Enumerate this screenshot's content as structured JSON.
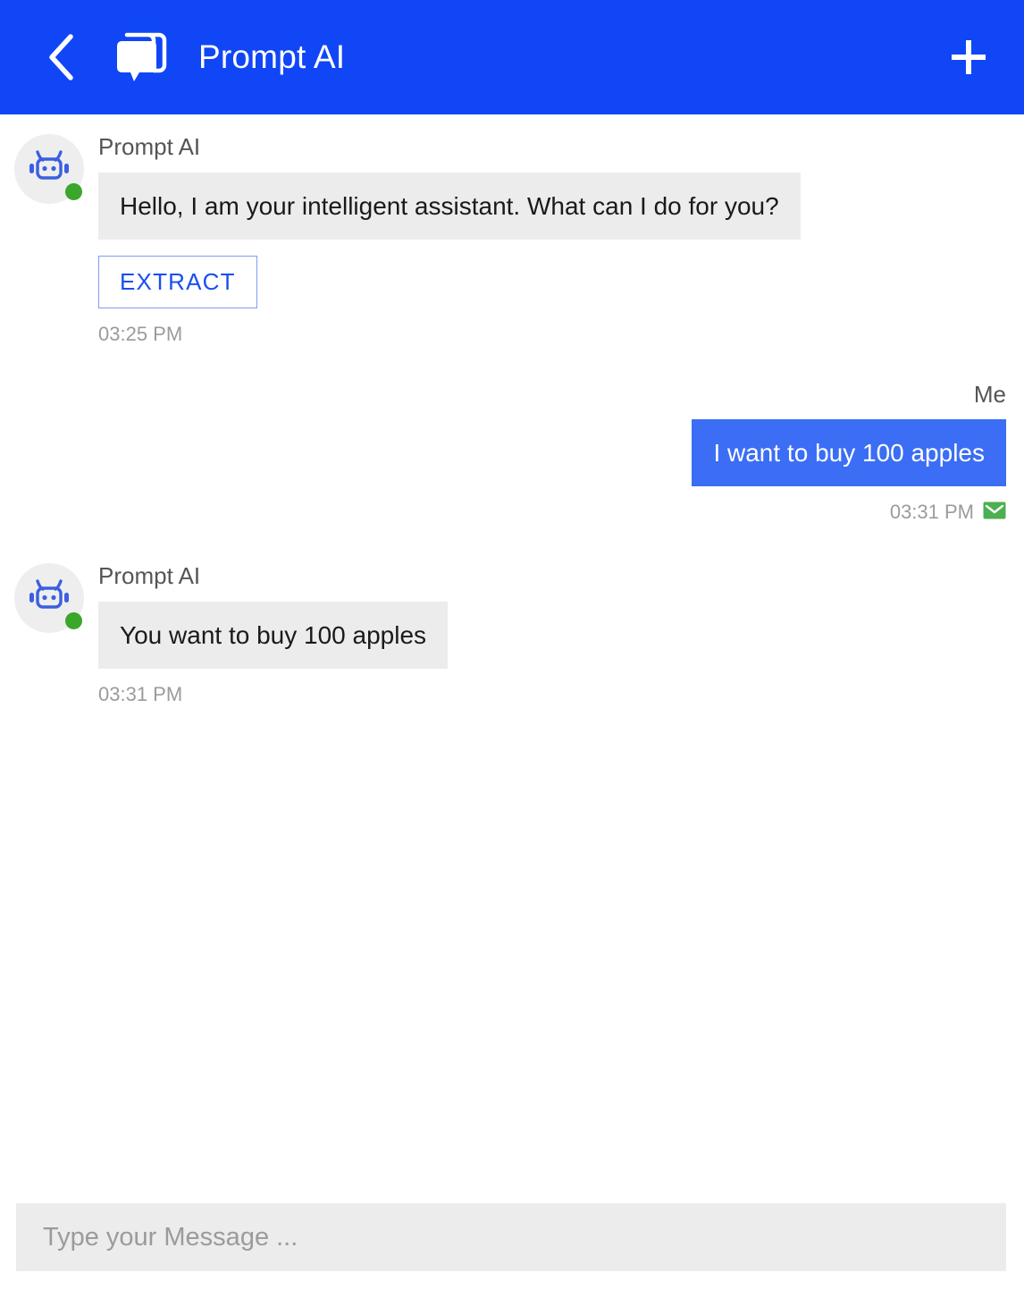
{
  "header": {
    "back_icon": "chevron-left-icon",
    "logo_icon": "chat-bubbles-icon",
    "title": "Prompt AI",
    "add_icon": "plus-icon"
  },
  "chat": {
    "messages": [
      {
        "side": "left",
        "sender": "Prompt AI",
        "text": "Hello, I am your intelligent assistant. What can I do for you?",
        "action_label": "EXTRACT",
        "timestamp": "03:25 PM",
        "avatar_icon": "robot-icon",
        "status": "online"
      },
      {
        "side": "right",
        "sender": "Me",
        "text": "I want to buy 100 apples",
        "timestamp": "03:31 PM",
        "status_icon": "envelope-sent-icon"
      },
      {
        "side": "left",
        "sender": "Prompt AI",
        "text": "You want to buy 100 apples",
        "timestamp": "03:31 PM",
        "avatar_icon": "robot-icon",
        "status": "online"
      }
    ]
  },
  "composer": {
    "placeholder": "Type your Message ...",
    "value": ""
  },
  "colors": {
    "header_blue": "#1046f5",
    "bubble_blue": "#3b6ef5",
    "bubble_gray": "#ececec",
    "accent_link": "#1a4df0",
    "status_green": "#3aa62a",
    "sent_green": "#4caf50"
  }
}
